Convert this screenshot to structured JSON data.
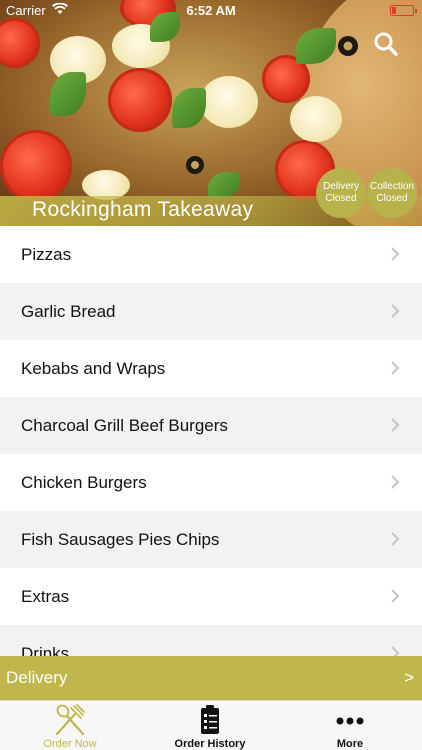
{
  "status_bar": {
    "carrier": "Carrier",
    "time": "6:52 AM"
  },
  "header": {
    "restaurant_name": "Rockingham Takeaway",
    "delivery_status": "Delivery Closed",
    "collection_status": "Collection Closed",
    "search_icon": "search-icon"
  },
  "menu": {
    "items": [
      {
        "label": "Pizzas"
      },
      {
        "label": "Garlic Bread"
      },
      {
        "label": "Kebabs and Wraps"
      },
      {
        "label": "Charcoal Grill Beef Burgers"
      },
      {
        "label": "Chicken Burgers"
      },
      {
        "label": "Fish Sausages Pies Chips"
      },
      {
        "label": "Extras"
      },
      {
        "label": "Drinks"
      }
    ]
  },
  "delivery_bar": {
    "label": "Delivery",
    "arrow": ">"
  },
  "tabs": [
    {
      "label": "Order Now",
      "icon": "utensils-icon",
      "active": true
    },
    {
      "label": "Order History",
      "icon": "clipboard-icon",
      "active": false
    },
    {
      "label": "More",
      "icon": "more-dots-icon",
      "active": false
    }
  ],
  "colors": {
    "accent": "#c1b64b",
    "badge": "#b8b24c",
    "battery": "#e53b2b"
  }
}
